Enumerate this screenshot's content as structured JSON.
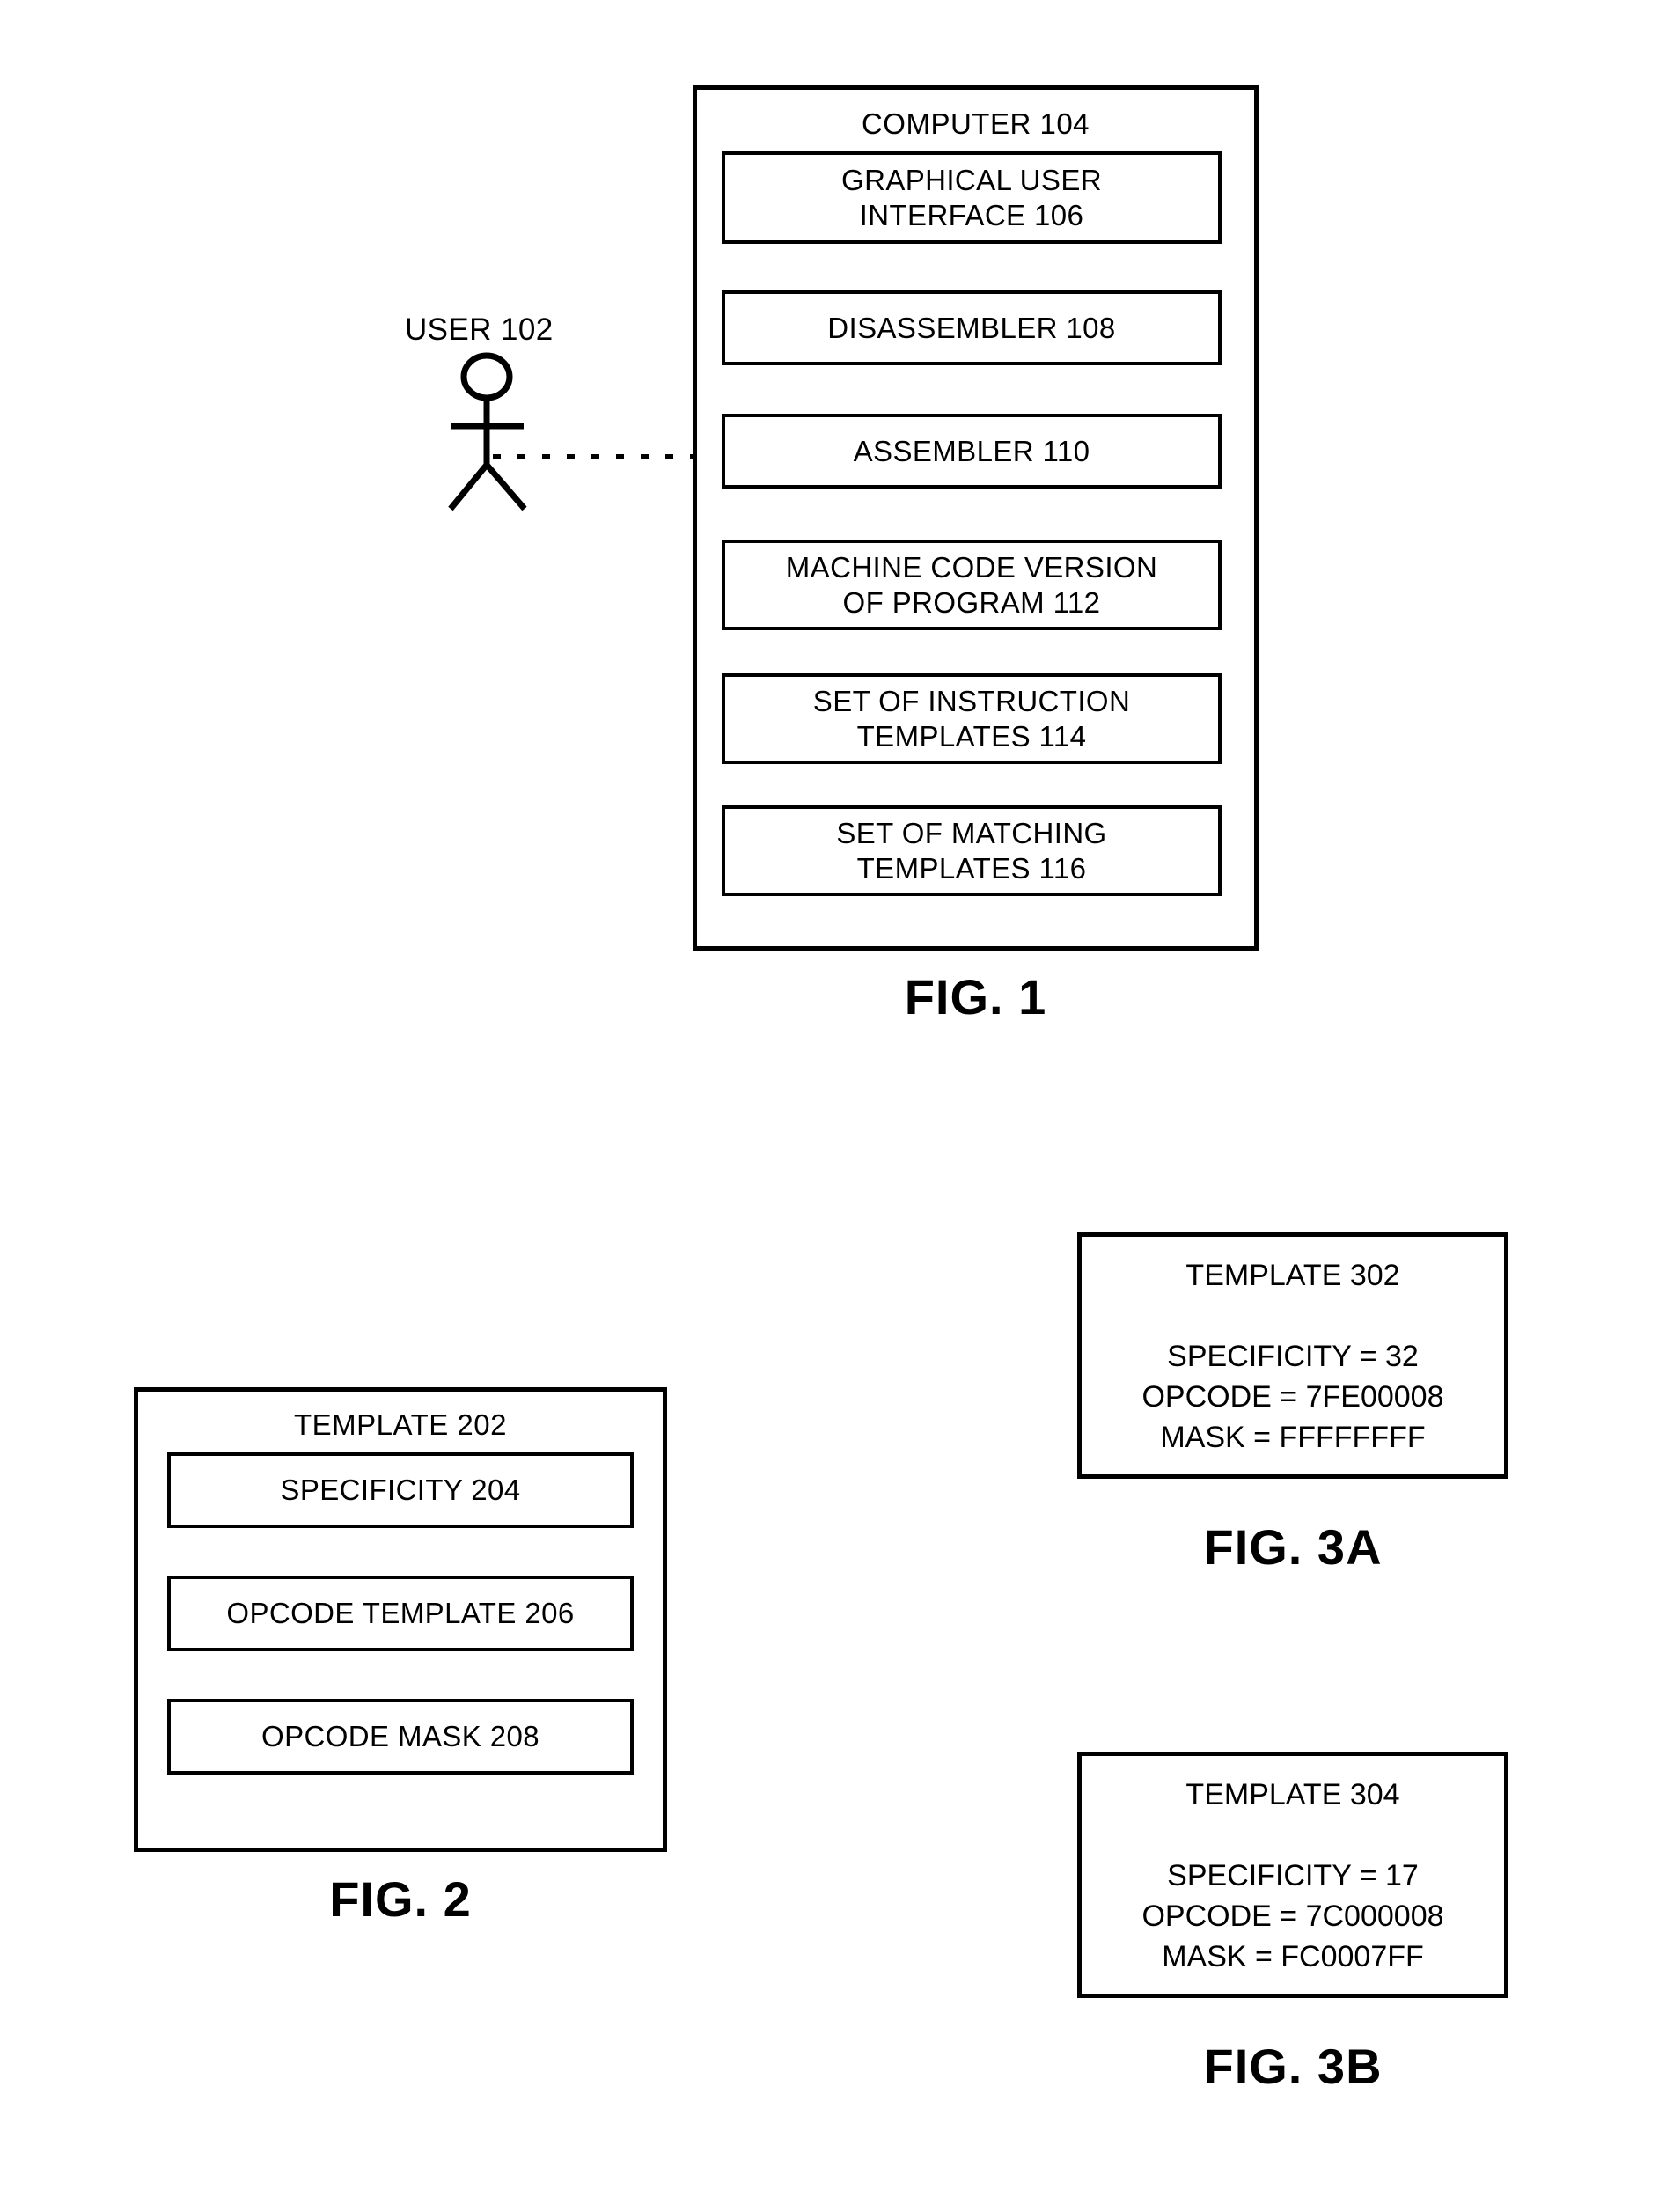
{
  "document": {
    "type": "patent-drawing-sheet",
    "background_color": "#ffffff",
    "line_color": "#000000"
  },
  "figure1": {
    "caption": "FIG. 1",
    "actor_label": "USER 102",
    "container_title": "COMPUTER 104",
    "components": [
      {
        "label": "GRAPHICAL USER\nINTERFACE 106"
      },
      {
        "label": "DISASSEMBLER 108"
      },
      {
        "label": "ASSEMBLER 110"
      },
      {
        "label": "MACHINE CODE VERSION\nOF PROGRAM 112"
      },
      {
        "label": "SET OF INSTRUCTION\nTEMPLATES 114"
      },
      {
        "label": "SET OF MATCHING\nTEMPLATES 116"
      }
    ]
  },
  "figure2": {
    "caption": "FIG. 2",
    "container_title": "TEMPLATE 202",
    "components": [
      {
        "label": "SPECIFICITY 204"
      },
      {
        "label": "OPCODE TEMPLATE 206"
      },
      {
        "label": "OPCODE MASK 208"
      }
    ]
  },
  "figure3a": {
    "caption": "FIG. 3A",
    "title": "TEMPLATE 302",
    "fields": [
      {
        "name": "SPECIFICITY",
        "value": "32",
        "line": "SPECIFICITY = 32"
      },
      {
        "name": "OPCODE",
        "value": "7FE00008",
        "line": "OPCODE = 7FE00008"
      },
      {
        "name": "MASK",
        "value": "FFFFFFFF",
        "line": "MASK = FFFFFFFF"
      }
    ],
    "body": "SPECIFICITY = 32\nOPCODE = 7FE00008\nMASK = FFFFFFFF"
  },
  "figure3b": {
    "caption": "FIG. 3B",
    "title": "TEMPLATE 304",
    "fields": [
      {
        "name": "SPECIFICITY",
        "value": "17",
        "line": "SPECIFICITY = 17"
      },
      {
        "name": "OPCODE",
        "value": "7C000008",
        "line": "OPCODE = 7C000008"
      },
      {
        "name": "MASK",
        "value": "FC0007FF",
        "line": "MASK = FC0007FF"
      }
    ],
    "body": "SPECIFICITY = 17\nOPCODE = 7C000008\nMASK = FC0007FF"
  }
}
